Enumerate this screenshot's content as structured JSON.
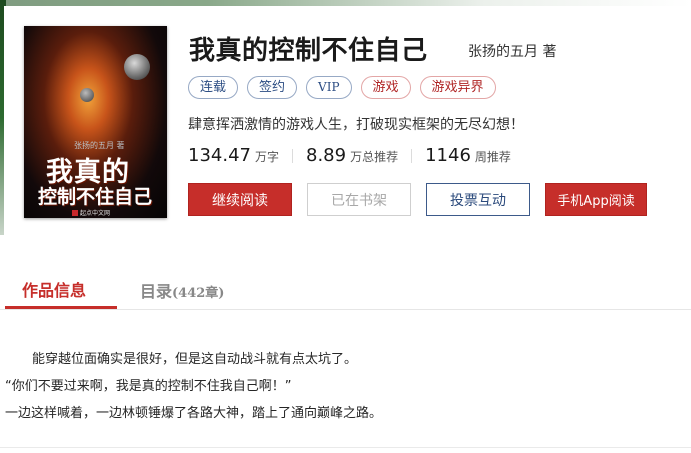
{
  "book": {
    "title": "我真的控制不住自己",
    "author": "张扬的五月 著",
    "tags": [
      {
        "label": "连载",
        "color": "#2c4d83"
      },
      {
        "label": "签约",
        "color": "#2c4d83"
      },
      {
        "label": "VIP",
        "color": "#2c4d83"
      },
      {
        "label": "游戏",
        "color": "#b02626"
      },
      {
        "label": "游戏异界",
        "color": "#b02626"
      }
    ],
    "intro": "肆意挥洒激情的游戏人生，打破现实框架的无尽幻想！",
    "stats": [
      {
        "value": "134.47",
        "unit": "万字"
      },
      {
        "value": "8.89",
        "unit": "万总推荐"
      },
      {
        "value": "1146",
        "unit": "周推荐"
      }
    ]
  },
  "cover": {
    "author_text": "张扬的五月 著",
    "title_line1": "我真的",
    "title_line2": "控制不住自己",
    "publisher": "起点中文网"
  },
  "buttons": {
    "continue_read": "继续阅读",
    "on_shelf": "已在书架",
    "vote": "投票互动",
    "app_read": "手机App阅读"
  },
  "tabs": {
    "info": "作品信息",
    "toc": "目录",
    "toc_count": "(442章)"
  },
  "description": [
    "能穿越位面确实是很好，但是这自动战斗就有点太坑了。",
    "“你们不要过来啊，我是真的控制不住我自己啊！”",
    "一边这样喊着，一边林顿锤爆了各路大神，踏上了通向巅峰之路。"
  ],
  "colors": {
    "accent_red": "#c62e2a",
    "tag_blue": "#2c4d83"
  }
}
